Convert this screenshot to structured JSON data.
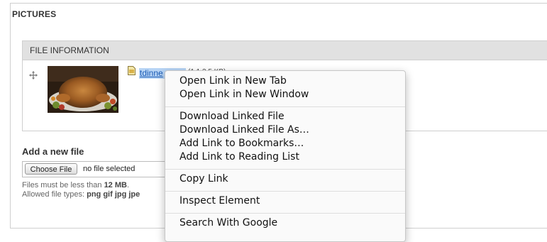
{
  "section": {
    "legend": "PICTURES"
  },
  "file_table": {
    "header": "FILE INFORMATION",
    "file": {
      "name": "tdinne",
      "size": "(1.1 3.5 KB)"
    },
    "drag_icon": "move-cross-icon",
    "file_icon": "image-file-icon"
  },
  "upload": {
    "title": "Add a new file",
    "choose_label": "Choose File",
    "no_file_text": "no file selected",
    "help_size_prefix": "Files must be less than ",
    "help_size_value": "12 MB",
    "help_size_suffix": ".",
    "help_types_prefix": "Allowed file types: ",
    "help_types_value": "png gif jpg jpe"
  },
  "context_menu": {
    "groups": [
      [
        "Open Link in New Tab",
        "Open Link in New Window"
      ],
      [
        "Download Linked File",
        "Download Linked File As…",
        "Add Link to Bookmarks…",
        "Add Link to Reading List"
      ],
      [
        "Copy Link"
      ],
      [
        "Inspect Element"
      ],
      [
        "Search With Google"
      ]
    ]
  }
}
